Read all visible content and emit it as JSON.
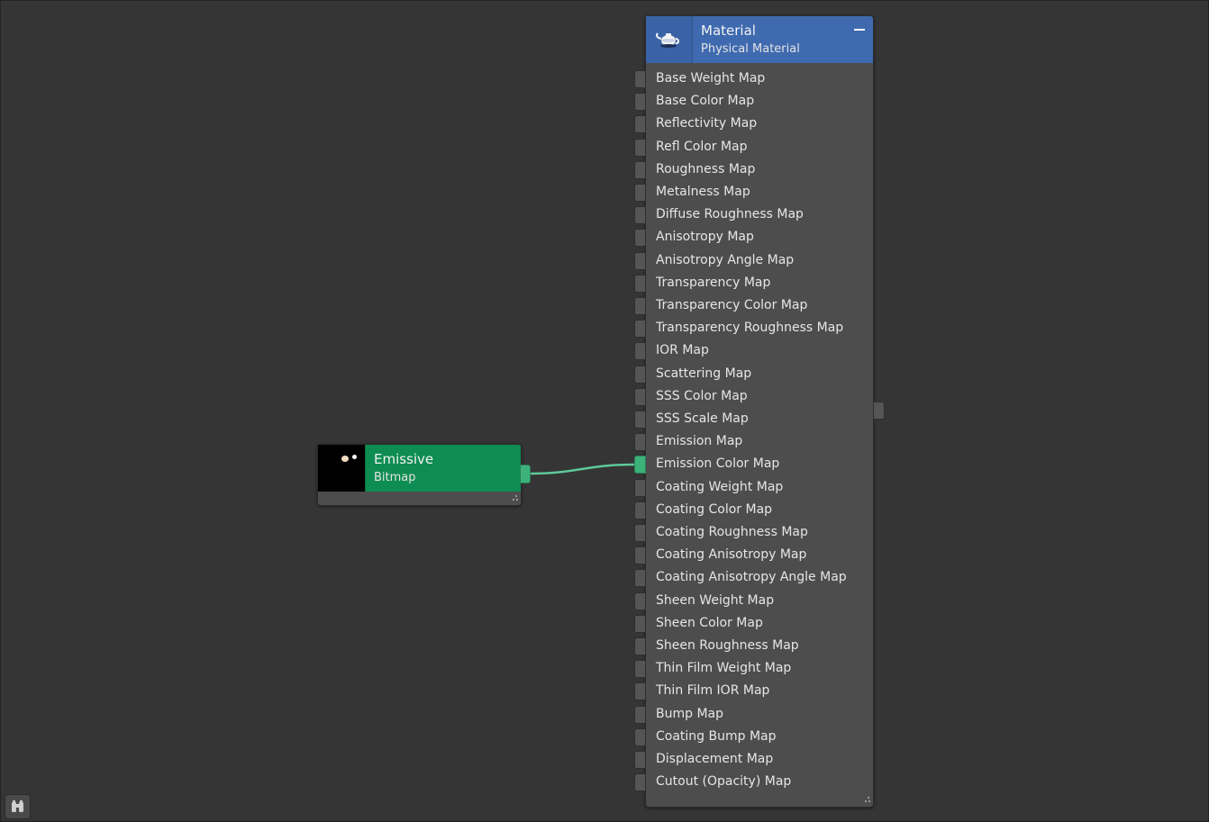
{
  "bitmap_node": {
    "title": "Emissive",
    "subtitle": "Bitmap",
    "header_color": "#0e8d52"
  },
  "material_node": {
    "title": "Material",
    "subtitle": "Physical Material",
    "header_color": "#3f6ab0",
    "icon": "teapot-icon",
    "connected_input": "Emission Color Map",
    "inputs": [
      "Base Weight Map",
      "Base Color Map",
      "Reflectivity Map",
      "Refl Color Map",
      "Roughness Map",
      "Metalness Map",
      "Diffuse Roughness Map",
      "Anisotropy Map",
      "Anisotropy Angle Map",
      "Transparency Map",
      "Transparency Color Map",
      "Transparency Roughness Map",
      "IOR Map",
      "Scattering Map",
      "SSS Color Map",
      "SSS Scale Map",
      "Emission Map",
      "Emission Color Map",
      "Coating Weight Map",
      "Coating Color Map",
      "Coating Roughness Map",
      "Coating Anisotropy Map",
      "Coating Anisotropy Angle Map",
      "Sheen Weight Map",
      "Sheen Color Map",
      "Sheen Roughness Map",
      "Thin Film Weight Map",
      "Thin Film IOR Map",
      "Bump Map",
      "Coating Bump Map",
      "Displacement Map",
      "Cutout (Opacity) Map"
    ]
  },
  "toolbar": {
    "binoculars_icon": "binoculars-icon"
  },
  "colors": {
    "canvas": "#353535",
    "connection_wire": "#5ec99a",
    "node_body": "#4d4d4d"
  }
}
